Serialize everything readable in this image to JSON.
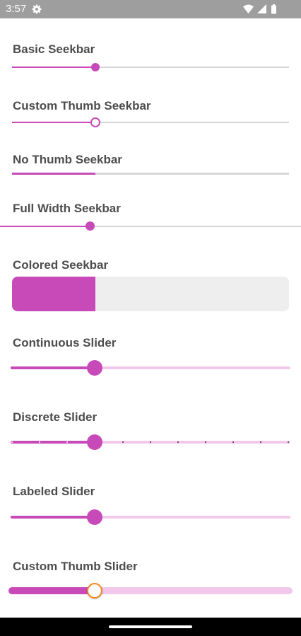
{
  "status_bar": {
    "time": "3:57",
    "icons": [
      "settings-gear-icon",
      "wifi-icon",
      "signal-icon",
      "battery-icon"
    ]
  },
  "colors": {
    "accent": "#c74ab8",
    "track_inactive": "#d6d6d6",
    "slider_inactive": "#f1c8ea",
    "colored_bg": "#eeeeee",
    "thumb_ring": "#f0871f"
  },
  "sections": {
    "basic_seekbar": {
      "label": "Basic Seekbar",
      "value": 0.3
    },
    "custom_thumb_seekbar": {
      "label": "Custom Thumb Seekbar",
      "value": 0.3
    },
    "no_thumb_seekbar": {
      "label": "No Thumb Seekbar",
      "value": 0.3
    },
    "full_width_seekbar": {
      "label": "Full Width Seekbar",
      "value": 0.3
    },
    "colored_seekbar": {
      "label": "Colored Seekbar",
      "value": 0.3
    },
    "continuous_slider": {
      "label": "Continuous Slider",
      "value": 0.3
    },
    "discrete_slider": {
      "label": "Discrete Slider",
      "value": 0.3,
      "steps": 10
    },
    "labeled_slider": {
      "label": "Labeled Slider",
      "value": 0.3
    },
    "custom_thumb_slider": {
      "label": "Custom Thumb Slider",
      "value": 0.3
    }
  }
}
